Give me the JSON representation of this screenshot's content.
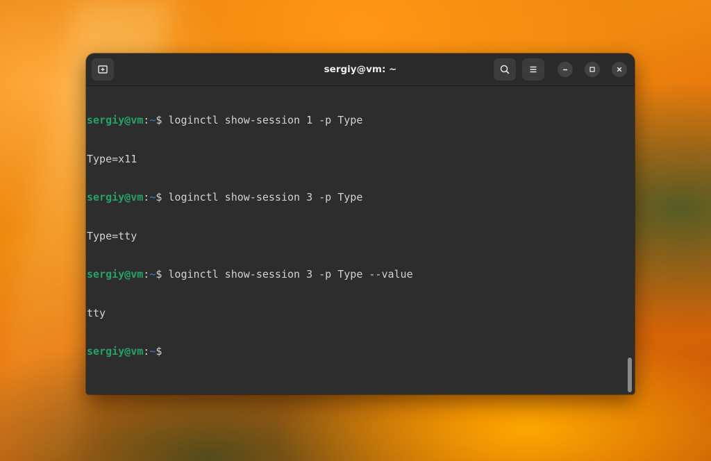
{
  "window": {
    "title": "sergiy@vm: ~"
  },
  "header_buttons": {
    "new_tab_icon": "new-tab-icon",
    "search_icon": "search-icon",
    "menu_icon": "hamburger-menu-icon"
  },
  "window_controls": {
    "minimize_icon": "minimize-icon",
    "maximize_icon": "maximize-icon",
    "close_icon": "close-icon"
  },
  "terminal": {
    "lines": [
      {
        "prompt_user": "sergiy@vm",
        "prompt_sep": ":",
        "prompt_path": "~",
        "prompt_symbol": "$",
        "command": " loginctl show-session 1 -p Type"
      },
      {
        "output": "Type=x11"
      },
      {
        "prompt_user": "sergiy@vm",
        "prompt_sep": ":",
        "prompt_path": "~",
        "prompt_symbol": "$",
        "command": " loginctl show-session 3 -p Type"
      },
      {
        "output": "Type=tty"
      },
      {
        "prompt_user": "sergiy@vm",
        "prompt_sep": ":",
        "prompt_path": "~",
        "prompt_symbol": "$",
        "command": " loginctl show-session 3 -p Type --value"
      },
      {
        "output": "tty"
      },
      {
        "prompt_user": "sergiy@vm",
        "prompt_sep": ":",
        "prompt_path": "~",
        "prompt_symbol": "$",
        "command": ""
      }
    ]
  },
  "colors": {
    "terminal_background": "#2d2d2d",
    "prompt_user": "#26a269",
    "prompt_path": "#3b6fb0",
    "text": "#d2d2d2"
  }
}
